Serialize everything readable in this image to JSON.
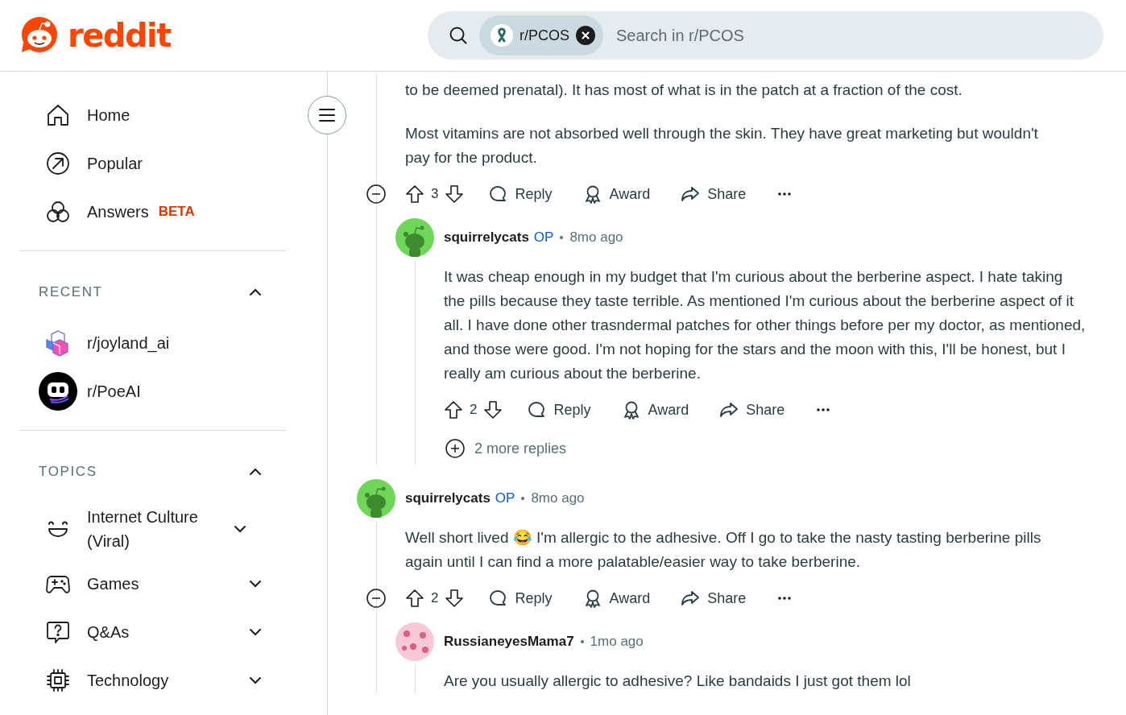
{
  "header": {
    "logo": "reddit",
    "community_chip": "r/PCOS",
    "search_placeholder": "Search in r/PCOS"
  },
  "sidebar": {
    "nav": [
      {
        "label": "Home",
        "kind": "home"
      },
      {
        "label": "Popular",
        "kind": "popular"
      },
      {
        "label": "Answers",
        "kind": "answers",
        "badge": "BETA"
      }
    ],
    "sections": [
      {
        "title": "RECENT",
        "expanded": true,
        "items": [
          {
            "label": "r/joyland_ai",
            "kind": "joyland"
          },
          {
            "label": "r/PoeAI",
            "kind": "poe"
          }
        ]
      },
      {
        "title": "TOPICS",
        "expanded": true,
        "items": [
          {
            "label": "Internet Culture (Viral)",
            "kind": "smile",
            "expanded": false
          },
          {
            "label": "Games",
            "kind": "gamepad",
            "expanded": false
          },
          {
            "label": "Q&As",
            "kind": "question",
            "expanded": false
          },
          {
            "label": "Technology",
            "kind": "chip",
            "expanded": false
          }
        ]
      }
    ]
  },
  "comments": [
    {
      "paragraphs": [
        "to be deemed prenatal). It has most of what is in the patch at a fraction of the cost.",
        "Most vitamins are not absorbed well through the skin. They have great marketing but wouldn't pay for the product."
      ],
      "votes": "3",
      "expanded": true,
      "actions": [
        {
          "kind": "reply",
          "label": "Reply"
        },
        {
          "kind": "award",
          "label": "Award"
        },
        {
          "kind": "share",
          "label": "Share"
        }
      ],
      "replies": [
        {
          "author": "squirrelycats",
          "op": "OP",
          "time": "8mo ago",
          "kind": "snoo",
          "paragraphs": [
            "It was cheap enough in my budget that I'm curious about the berberine aspect. I hate taking the pills because they taste terrible. As mentioned I'm curious about the berberine aspect of it all. I have done other trasndermal patches for other things before per my doctor, as mentioned, and those were good. I'm not hoping for the stars and the moon with this, I'll be honest, but I really am curious about the berberine."
          ],
          "votes": "2",
          "actions": [
            {
              "kind": "reply",
              "label": "Reply"
            },
            {
              "kind": "award",
              "label": "Award"
            },
            {
              "kind": "share",
              "label": "Share"
            }
          ],
          "more_replies": "2 more replies"
        }
      ]
    },
    {
      "author": "squirrelycats",
      "op": "OP",
      "time": "8mo ago",
      "kind": "snoo",
      "paragraphs": [
        "Well short lived 😂 I'm allergic to the adhesive. Off I go to take the nasty tasting berberine pills again until I can find a more palatable/easier way to take berberine."
      ],
      "votes": "2",
      "expanded": true,
      "actions": [
        {
          "kind": "reply",
          "label": "Reply"
        },
        {
          "kind": "award",
          "label": "Award"
        },
        {
          "kind": "share",
          "label": "Share"
        }
      ],
      "replies": [
        {
          "author": "RussianeyesMama7",
          "time": "1mo ago",
          "kind": "pattern",
          "paragraphs": [
            "Are you usually allergic to adhesive? Like bandaids I just got them lol"
          ]
        }
      ]
    }
  ]
}
